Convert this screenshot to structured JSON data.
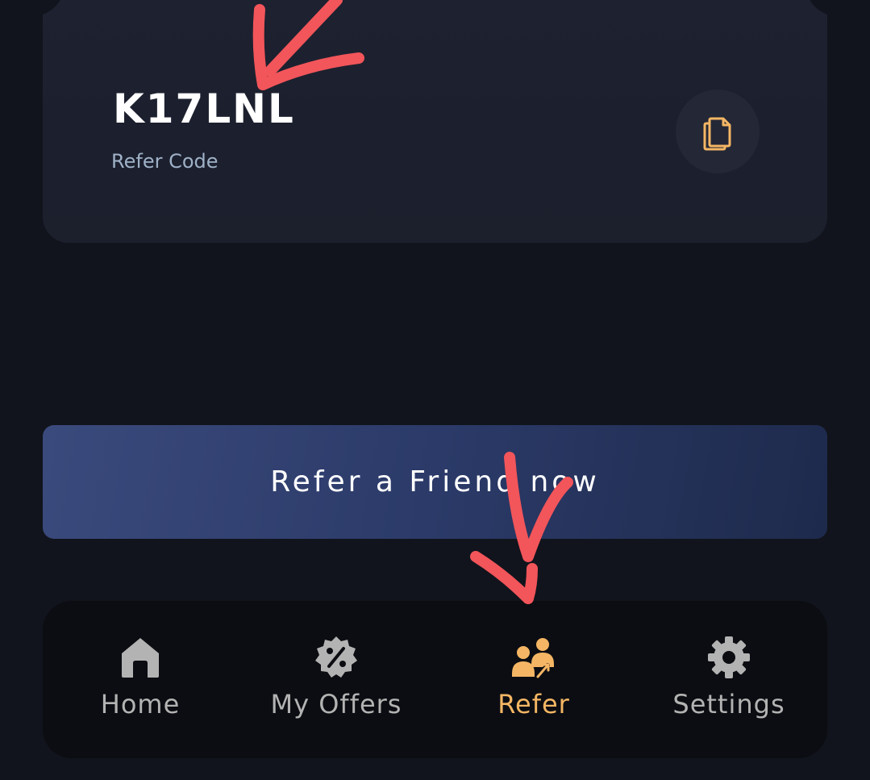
{
  "refer_card": {
    "code": "K17LNL",
    "label": "Refer Code",
    "copy_icon": "copy-icon"
  },
  "refer_button": {
    "label": "Refer a Friend now"
  },
  "bottom_nav": {
    "items": [
      {
        "label": "Home",
        "icon": "home-icon",
        "active": false
      },
      {
        "label": "My Offers",
        "icon": "offer-badge-icon",
        "active": false
      },
      {
        "label": "Refer",
        "icon": "refer-users-icon",
        "active": true
      },
      {
        "label": "Settings",
        "icon": "gear-icon",
        "active": false
      }
    ]
  },
  "colors": {
    "background": "#11141c",
    "card": "#1d2130",
    "accent": "#f4b664",
    "nav_inactive": "#b3b3b3",
    "annotation": "#f2555a"
  }
}
